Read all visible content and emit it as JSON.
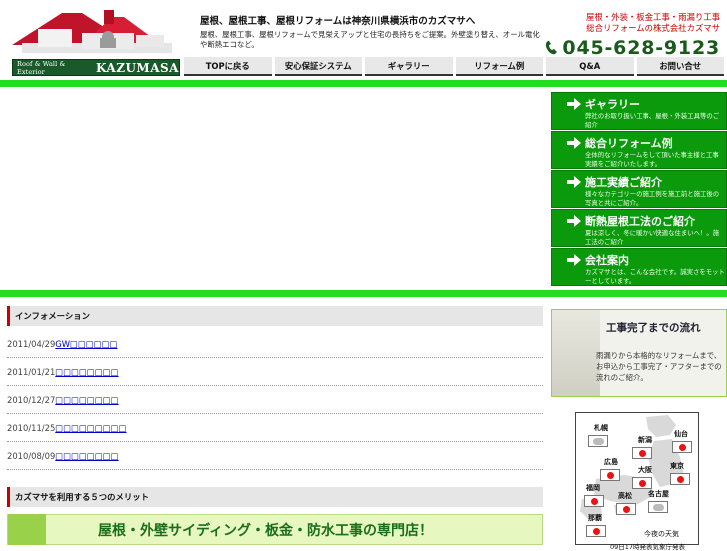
{
  "header": {
    "logo_sub": "Roof & Wall & Exterior",
    "logo_brand": "KAZUMASA",
    "title": "屋根、屋根工事、屋根リフォームは神奈川県横浜市のカズマサへ",
    "desc": "屋根、屋根工事、屋根リフォームで見栄えアップと住宅の長持ちをご提案。外壁塗り替え、オール電化や断熱エコなど。",
    "right_line1": "屋根・外装・板金工事・雨漏り工事",
    "right_line2": "総合リフォームの株式会社カズマサ",
    "phone": "045-628-9123"
  },
  "nav": [
    {
      "label": "TOPに戻る"
    },
    {
      "label": "安心保証システム"
    },
    {
      "label": "ギャラリー"
    },
    {
      "label": "リフォーム例"
    },
    {
      "label": "Q&A"
    },
    {
      "label": "お問い合せ"
    }
  ],
  "side_menu": [
    {
      "title": "ギャラリー",
      "desc": "弊社のお取り扱い工事、屋根・外装工具等のご紹介"
    },
    {
      "title": "総合リフォーム例",
      "desc": "全体的なリフォームをして頂いた事主様と工事実績をご紹介いたします。"
    },
    {
      "title": "施工実績ご紹介",
      "desc": "様々なカテゴリーの施工例を施工前と施工後の写真と共にご紹介。"
    },
    {
      "title": "断熱屋根工法のご紹介",
      "desc": "夏は涼しく、冬に暖かい快適な住まいへ！。施工法のご紹介"
    },
    {
      "title": "会社案内",
      "desc": "カズマサとは、こんな会社です。誠実さをモットーとしています。"
    }
  ],
  "info": {
    "heading": "インフォメーション",
    "items": [
      {
        "date": "2011/04/29",
        "text": "GW□□□□□□"
      },
      {
        "date": "2011/01/21",
        "text": "□□□□□□□□"
      },
      {
        "date": "2010/12/27",
        "text": "□□□□□□□□"
      },
      {
        "date": "2010/11/25",
        "text": "□□□□□□□□□"
      },
      {
        "date": "2010/08/09",
        "text": "□□□□□□□□"
      }
    ]
  },
  "merit_heading": "カズマサを利用する５つのメリット",
  "banner_text": "屋根・外壁サイディング・板金・防水工事の専門店！",
  "flow": {
    "title": "工事完了までの流れ",
    "desc": "雨漏りから本格的なリフォームまで、お申込から工事完了・アフターまでの流れのご紹介。"
  },
  "weather": {
    "cities": [
      "札幌",
      "新潟",
      "仙台",
      "広島",
      "大阪",
      "東京",
      "福岡",
      "高松",
      "名古屋",
      "那覇"
    ],
    "footer": "今夜の天気",
    "footer2": "09日17時発表気象庁発表"
  },
  "colors": {
    "brand_green": "#0b9a0b",
    "accent_green": "#22dd22",
    "phone_green": "#1a5a1a",
    "header_red": "#c00"
  }
}
